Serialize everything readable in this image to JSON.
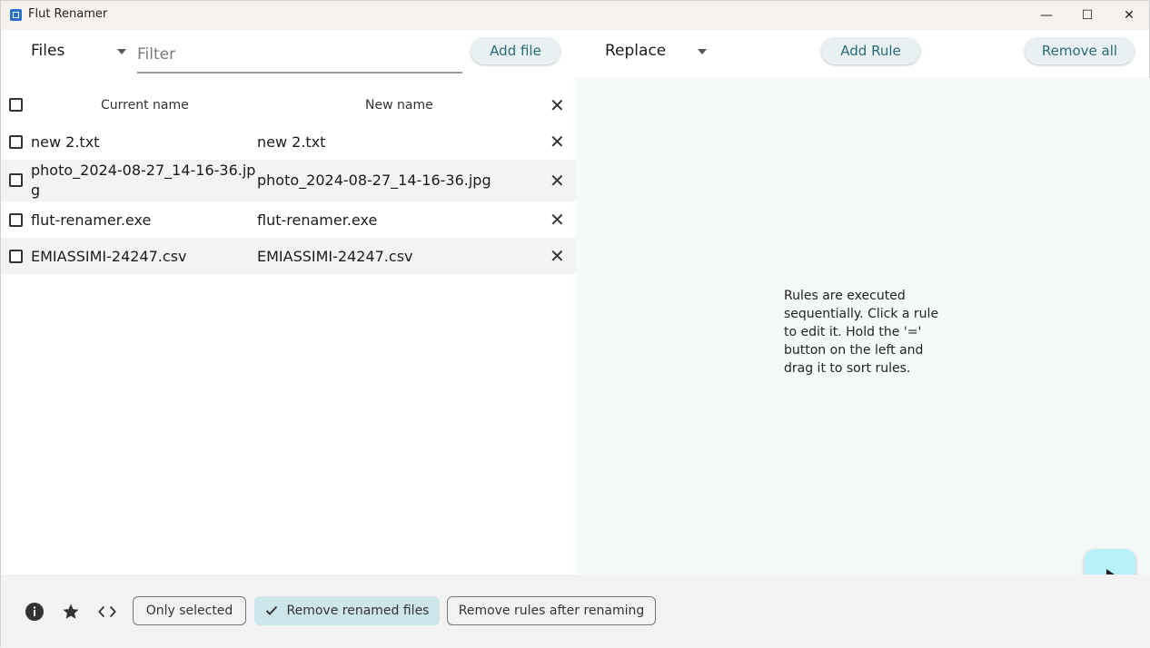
{
  "window": {
    "title": "Flut Renamer",
    "minimize_glyph": "—",
    "maximize_glyph": "☐",
    "close_glyph": "✕"
  },
  "toolbar": {
    "files_label": "Files",
    "filter_placeholder": "Filter",
    "add_file_label": "Add file",
    "rule_type_label": "Replace",
    "add_rule_label": "Add Rule",
    "remove_all_label": "Remove all"
  },
  "table": {
    "columns": [
      "Current name",
      "New name"
    ],
    "rows": [
      {
        "current": "new 2.txt",
        "new": "new 2.txt"
      },
      {
        "current": "photo_2024-08-27_14-16-36.jp\ng",
        "new": "photo_2024-08-27_14-16-36.jpg"
      },
      {
        "current": "flut-renamer.exe",
        "new": "flut-renamer.exe"
      },
      {
        "current": "EMIASSIMI-24247.csv",
        "new": "EMIASSIMI-24247.csv"
      }
    ]
  },
  "rules": {
    "help_text": "Rules are executed sequentially. Click a rule to edit it. Hold the '=' button on the left and drag it to sort rules."
  },
  "bottom": {
    "only_selected_label": "Only selected",
    "remove_renamed_label": "Remove renamed files",
    "remove_renamed_checked": true,
    "remove_rules_label": "Remove rules after renaming",
    "icons": [
      "info-icon",
      "star-icon",
      "code-icon"
    ]
  },
  "colors": {
    "accent": "#2b6a78",
    "run_button": "#b9f1f8",
    "chip_selected": "#cde6ec"
  }
}
